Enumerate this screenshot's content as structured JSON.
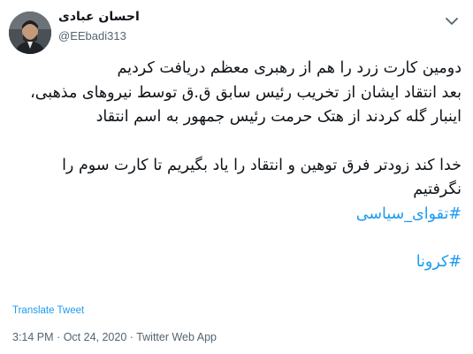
{
  "author": {
    "name": "احسان عبادی",
    "handle": "@EEbadi313"
  },
  "tweet": {
    "lines": [
      "دومین کارت زرد را هم از رهبری معظم دریافت کردیم",
      "بعد انتقاد ایشان از تخریب رئیس سابق ق.ق توسط نیروهای مذهبی، اینبار گله کردند از هتک حرمت رئیس جمهور به اسم انتقاد",
      "خدا کند زودتر فرق توهین و انتقاد را یاد بگیریم تا کارت سوم را نگرفتیم"
    ],
    "hashtags": [
      "#تقوای_سیاسی",
      "#کرونا"
    ]
  },
  "translate_label": "Translate Tweet",
  "meta": {
    "time": "3:14 PM",
    "separator": "·",
    "date": "Oct 24, 2020",
    "source": "Twitter Web App"
  },
  "icons": {
    "more": "chevron-down-icon"
  },
  "colors": {
    "link": "#1d9bf0",
    "text": "#0f1419",
    "secondary": "#536471"
  }
}
